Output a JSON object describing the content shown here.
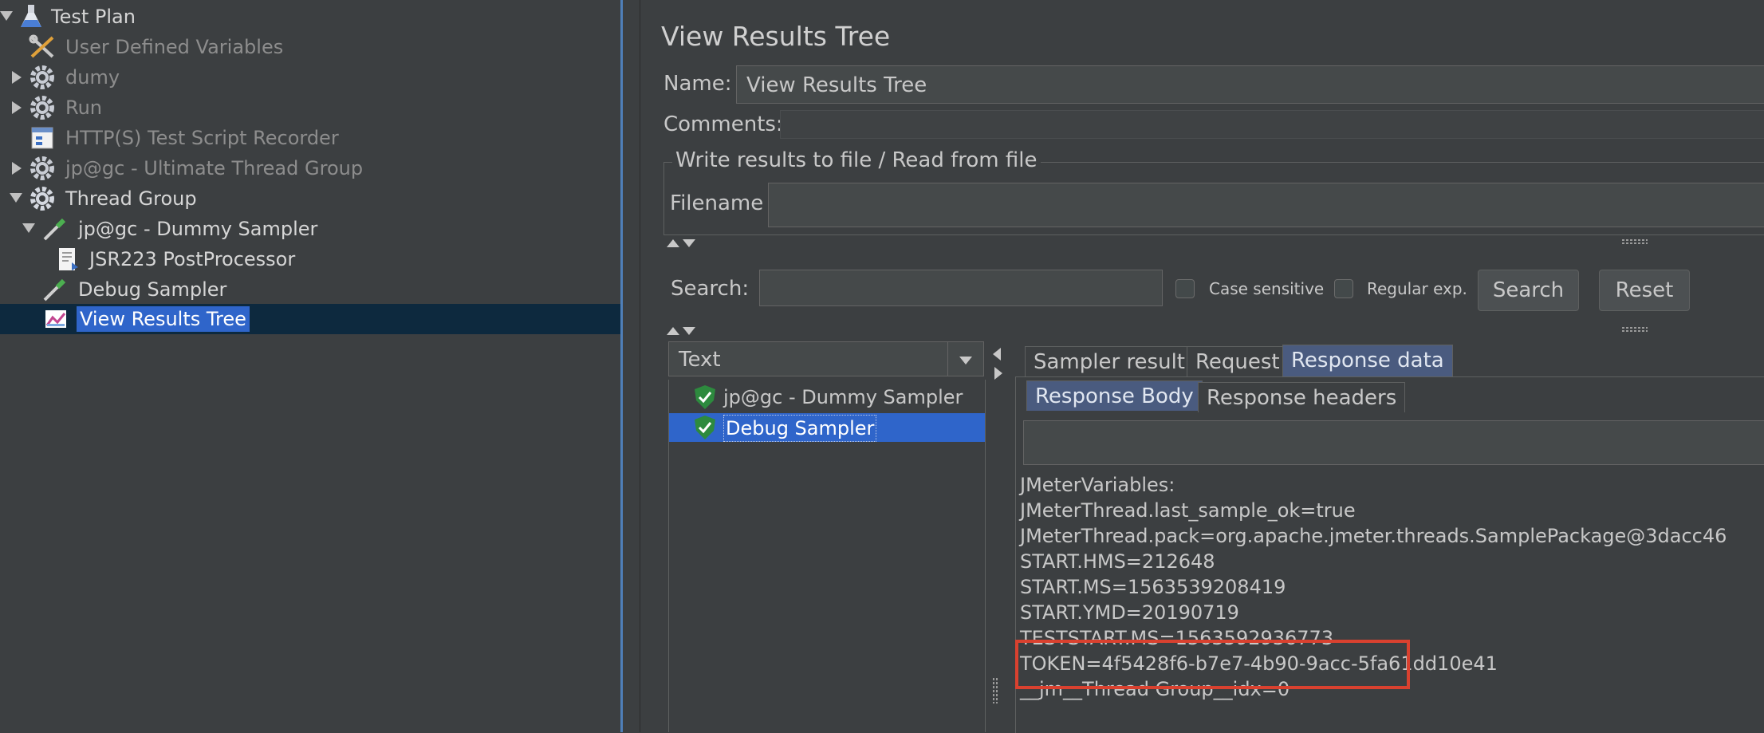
{
  "tree": {
    "items": [
      {
        "label": "Test Plan",
        "enabled": true,
        "icon": "flask-icon"
      },
      {
        "label": "User Defined Variables",
        "enabled": false,
        "icon": "tools-icon"
      },
      {
        "label": "dumy",
        "enabled": false,
        "icon": "gear-icon"
      },
      {
        "label": "Run",
        "enabled": false,
        "icon": "gear-icon"
      },
      {
        "label": "HTTP(S) Test Script Recorder",
        "enabled": false,
        "icon": "recorder-icon"
      },
      {
        "label": "jp@gc - Ultimate Thread Group",
        "enabled": false,
        "icon": "gear-icon"
      },
      {
        "label": "Thread Group",
        "enabled": true,
        "icon": "gear-icon"
      },
      {
        "label": "jp@gc - Dummy Sampler",
        "enabled": true,
        "icon": "pipette-icon"
      },
      {
        "label": "JSR223 PostProcessor",
        "enabled": true,
        "icon": "script-icon"
      },
      {
        "label": "Debug Sampler",
        "enabled": true,
        "icon": "pipette-icon"
      },
      {
        "label": "View Results Tree",
        "enabled": true,
        "icon": "chart-icon",
        "selected": true
      }
    ]
  },
  "panel": {
    "title": "View Results Tree",
    "name_label": "Name:",
    "name_value": "View Results Tree",
    "comments_label": "Comments:",
    "file_group_title": "Write results to file / Read from file",
    "filename_label": "Filename",
    "search_label": "Search:",
    "case_sensitive_label": "Case sensitive",
    "regular_exp_label": "Regular exp.",
    "search_button": "Search",
    "reset_button": "Reset",
    "renderer_value": "Text",
    "samples": [
      {
        "label": "jp@gc - Dummy Sampler",
        "status": "success"
      },
      {
        "label": "Debug Sampler",
        "status": "success",
        "selected": true
      }
    ],
    "tabs": [
      "Sampler result",
      "Request",
      "Response data"
    ],
    "active_tab": "Response data",
    "subtabs": [
      "Response Body",
      "Response headers"
    ],
    "active_subtab": "Response Body",
    "response_lines": [
      "JMeterVariables:",
      "JMeterThread.last_sample_ok=true",
      "JMeterThread.pack=org.apache.jmeter.threads.SamplePackage@3dacc46",
      "START.HMS=212648",
      "START.MS=1563539208419",
      "START.YMD=20190719",
      "TESTSTART.MS=1563592936773",
      "TOKEN=4f5428f6-b7e7-4b90-9acc-5fa61dd10e41",
      "__jm__Thread Group__idx=0"
    ],
    "highlight_color": "#d9412f"
  }
}
